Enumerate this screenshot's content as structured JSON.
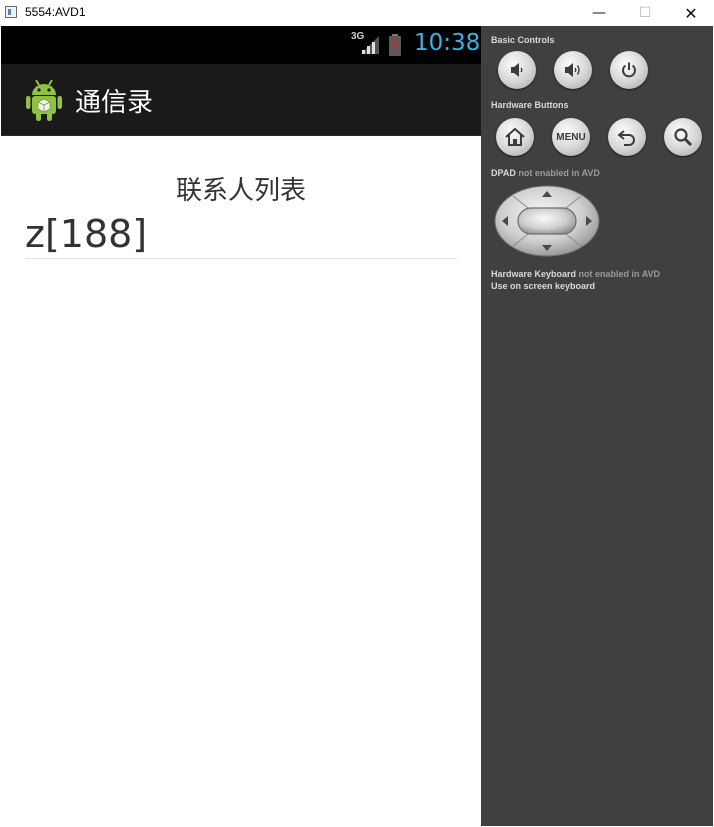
{
  "window": {
    "title": "5554:AVD1",
    "minimize_glyph": "—",
    "maximize_glyph": "☐",
    "close_glyph": "✕"
  },
  "status_bar": {
    "network_type": "3G",
    "clock": "10:38",
    "clock_color": "#33b5e5"
  },
  "action_bar": {
    "app_title": "通信录",
    "logo_icon": "android-robot-icon"
  },
  "content": {
    "header": "联系人列表",
    "contacts": [
      {
        "text": "z[188]"
      }
    ]
  },
  "controls": {
    "basic_controls_label": "Basic Controls",
    "basic_buttons": [
      "volume-down-icon",
      "volume-up-icon",
      "power-icon"
    ],
    "hardware_buttons_label": "Hardware Buttons",
    "hardware_buttons": [
      "home-icon",
      "menu-button",
      "back-icon",
      "search-icon"
    ],
    "menu_label": "MENU",
    "dpad_label": "DPAD",
    "dpad_note": "not enabled in AVD",
    "keyboard_label": "Hardware Keyboard",
    "keyboard_note": "not enabled in AVD",
    "keyboard_hint": "Use on screen keyboard"
  }
}
